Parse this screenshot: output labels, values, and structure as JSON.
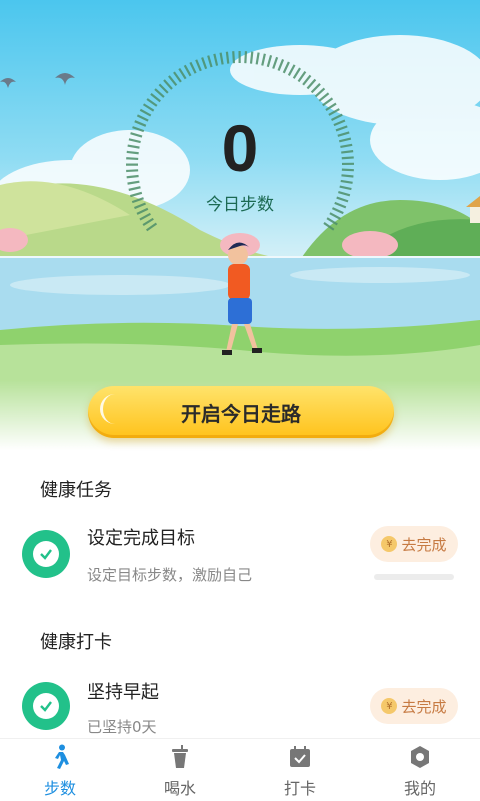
{
  "today": {
    "steps": "0",
    "label": "今日步数"
  },
  "start_button": {
    "label": "开启今日走路"
  },
  "health_tasks": {
    "title": "健康任务",
    "items": [
      {
        "title": "设定完成目标",
        "subtitle": "设定目标步数，激励自己",
        "action": "去完成"
      }
    ]
  },
  "health_checkin": {
    "title": "健康打卡",
    "items": [
      {
        "title": "坚持早起",
        "subtitle": "已坚持0天",
        "action": "去完成"
      }
    ]
  },
  "coin_symbol": "¥",
  "tabs": [
    {
      "label": "步数",
      "icon": "walking-icon",
      "active": true
    },
    {
      "label": "喝水",
      "icon": "cup-icon",
      "active": false
    },
    {
      "label": "打卡",
      "icon": "calendar-check-icon",
      "active": false
    },
    {
      "label": "我的",
      "icon": "hexagon-user-icon",
      "active": false
    }
  ],
  "colors": {
    "accent": "#1e8fe0",
    "green": "#22c18a",
    "button_yellow": "#ffc21a"
  }
}
